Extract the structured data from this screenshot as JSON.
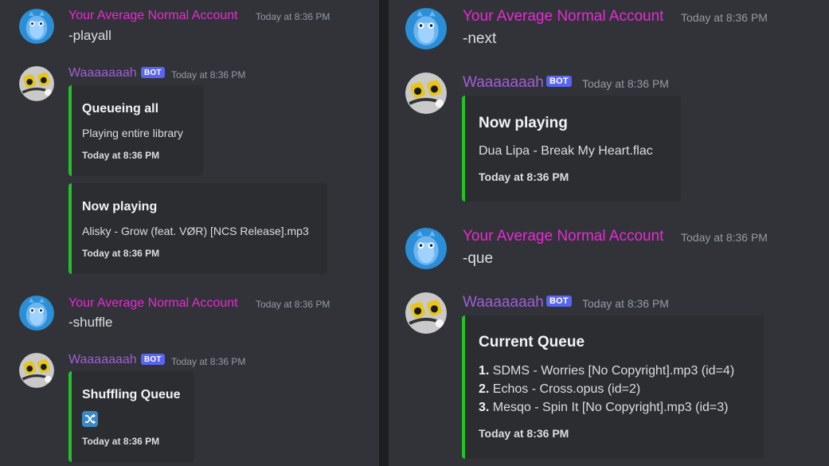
{
  "colors": {
    "background": "#313338",
    "human_username": "#e829d6",
    "bot_username": "#a05ed6",
    "bot_tag": "#5865f2",
    "embed_bar": "#23c227",
    "embed_bg": "#2b2d31"
  },
  "left": {
    "messages": [
      {
        "author": "Your Average Normal Account",
        "timestamp": "Today at 8:36 PM",
        "content": "-playall"
      },
      {
        "author": "Waaaaaaah",
        "bot_tag": "BOT",
        "timestamp": "Today at 8:36 PM",
        "embeds": [
          {
            "title": "Queueing all",
            "description": "Playing entire library",
            "footer": "Today at 8:36 PM"
          },
          {
            "title": "Now playing",
            "description": "Alisky - Grow (feat. VØR) [NCS Release].mp3",
            "footer": "Today at 8:36 PM"
          }
        ]
      },
      {
        "author": "Your Average Normal Account",
        "timestamp": "Today at 8:36 PM",
        "content": "-shuffle"
      },
      {
        "author": "Waaaaaaah",
        "bot_tag": "BOT",
        "timestamp": "Today at 8:36 PM",
        "embeds": [
          {
            "title": "Shuffling Queue",
            "emoji": "shuffle-icon",
            "footer": "Today at 8:36 PM"
          }
        ]
      }
    ]
  },
  "right": {
    "messages": [
      {
        "author": "Your Average Normal Account",
        "timestamp": "Today at 8:36 PM",
        "content": "-next"
      },
      {
        "author": "Waaaaaaah",
        "bot_tag": "BOT",
        "timestamp": "Today at 8:36 PM",
        "embeds": [
          {
            "title": "Now playing",
            "description": "Dua Lipa - Break My Heart.flac",
            "footer": "Today at 8:36 PM"
          }
        ]
      },
      {
        "author": "Your Average Normal Account",
        "timestamp": "Today at 8:36 PM",
        "content": "-que"
      },
      {
        "author": "Waaaaaaah",
        "bot_tag": "BOT",
        "timestamp": "Today at 8:36 PM",
        "embeds": [
          {
            "title": "Current Queue",
            "queue": [
              {
                "num": "1.",
                "text": "SDMS - Worries [No Copyright].mp3 (id=4)"
              },
              {
                "num": "2.",
                "text": "Echos - Cross.opus (id=2)"
              },
              {
                "num": "3.",
                "text": "Mesqo - Spin It [No Copyright].mp3 (id=3)"
              }
            ],
            "footer": "Today at 8:36 PM"
          }
        ]
      }
    ]
  }
}
